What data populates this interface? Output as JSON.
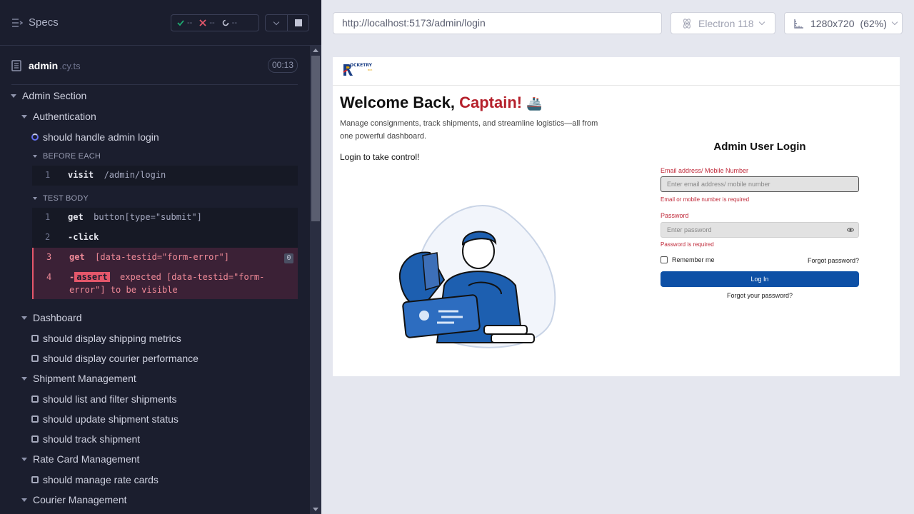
{
  "runner": {
    "specs_label": "Specs",
    "stats": {
      "passed": "--",
      "failed": "--",
      "pending": "--"
    },
    "file": {
      "name": "admin",
      "ext": ".cy.ts",
      "time": "00:13"
    },
    "suite": "Admin Section",
    "auth_group": "Authentication",
    "running_test": "should handle admin login",
    "before_each_label": "BEFORE EACH",
    "test_body_label": "TEST BODY",
    "before_each_cmds": [
      {
        "num": "1",
        "name": "visit",
        "arg": "/admin/login"
      }
    ],
    "body_cmds": [
      {
        "num": "1",
        "name": "get",
        "arg": "button[type=\"submit\"]"
      },
      {
        "num": "2",
        "name": "-click",
        "arg": ""
      },
      {
        "num": "3",
        "name": "get",
        "arg": "[data-testid=\"form-error\"]",
        "badge": "0"
      },
      {
        "num": "4",
        "name": "-",
        "badge_text": "assert",
        "arg_line1": "expected [data-testid=\"form-",
        "arg_line2": "error\"] to be visible"
      }
    ],
    "groups": [
      {
        "title": "Dashboard",
        "tests": [
          "should display shipping metrics",
          "should display courier performance"
        ]
      },
      {
        "title": "Shipment Management",
        "tests": [
          "should list and filter shipments",
          "should update shipment status",
          "should track shipment"
        ]
      },
      {
        "title": "Rate Card Management",
        "tests": [
          "should manage rate cards"
        ]
      },
      {
        "title": "Courier Management",
        "tests": []
      }
    ]
  },
  "aut_bar": {
    "url": "http://localhost:5173/admin/login",
    "browser": "Electron 118",
    "viewport": "1280x720",
    "scale": "(62%)"
  },
  "app": {
    "logo_text": "OCKETRY",
    "logo_sub": "BOX",
    "welcome_prefix": "Welcome Back, ",
    "welcome_name": "Captain!",
    "welcome_emoji": "🚢",
    "description": "Manage consignments, track shipments, and streamline logistics—all from one powerful dashboard.",
    "take_control": "Login to take control!",
    "login": {
      "title": "Admin User Login",
      "email_label": "Email address/ Mobile Number",
      "email_placeholder": "Enter email address/ mobile number",
      "email_error": "Email or mobile number is required",
      "password_label": "Password",
      "password_placeholder": "Enter password",
      "password_error": "Password is required",
      "remember": "Remember me",
      "forgot": "Forgot password?",
      "button": "Log In",
      "forgot_link": "Forgot your password?"
    }
  },
  "colors": {
    "runner_bg": "#1b1e2e",
    "fail": "#e5576b",
    "captain_red": "#b5202b",
    "login_button": "#0d50a6"
  }
}
